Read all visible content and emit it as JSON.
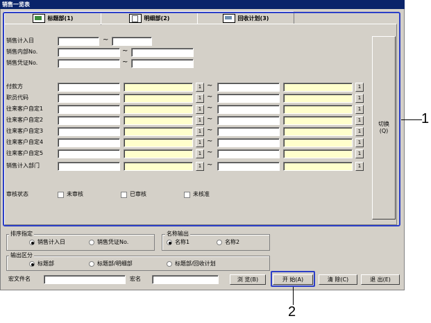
{
  "window": {
    "title": "销售一览表"
  },
  "tabs": [
    {
      "label": "标题部(1)"
    },
    {
      "label": "明细部(2)"
    },
    {
      "label": "回收计划(3)"
    }
  ],
  "range_fields": [
    {
      "label": "销售计入日"
    },
    {
      "label": "销售内部No."
    },
    {
      "label": "销售凭证No."
    }
  ],
  "range_rows": [
    {
      "label": "付款方"
    },
    {
      "label": "职员代码"
    },
    {
      "label": "往来客户自定1"
    },
    {
      "label": "往来客户自定2"
    },
    {
      "label": "往来客户自定3"
    },
    {
      "label": "往来客户自定4"
    },
    {
      "label": "往来客户自定5"
    },
    {
      "label": "销售计入部门"
    }
  ],
  "tilde": "~",
  "small_button_label": "1",
  "switch_button": {
    "label_line1": "切换",
    "label_line2": "(Q)"
  },
  "audit": {
    "label": "审核状态",
    "options": [
      "未审核",
      "已审核",
      "未核准"
    ]
  },
  "sort": {
    "title": "排序指定",
    "options": [
      "销售计入日",
      "销售凭证No."
    ],
    "selected": 0
  },
  "name_output": {
    "title": "名称输出",
    "options": [
      "名称1",
      "名称2"
    ],
    "selected": 0
  },
  "output_section": {
    "title": "输出区分",
    "options": [
      "标题部",
      "标题部/明细部",
      "标题部/回收计划"
    ],
    "selected": 0
  },
  "bottom": {
    "macro_file_label": "宏文件名",
    "macro_name_label": "宏名",
    "browse_button": "浏 览(B)",
    "start_button": "开 始(A)",
    "clear_button": "清 除(C)",
    "exit_button": "退 出(E)"
  },
  "callouts": [
    "1",
    "2"
  ],
  "colors": {
    "highlight": "#2b3ec8",
    "title_bar": "#0a246a",
    "yellow_field": "#ffffcc"
  }
}
